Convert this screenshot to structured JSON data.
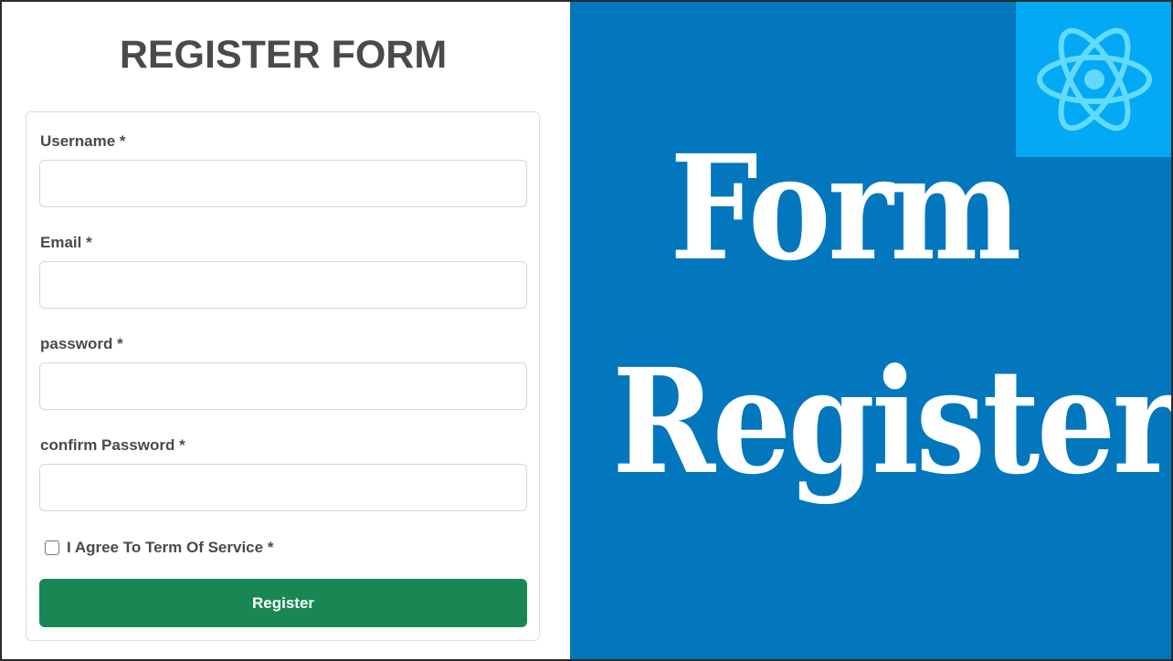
{
  "form": {
    "title": "REGISTER FORM",
    "fields": [
      {
        "label": "Username *",
        "value": "",
        "placeholder": ""
      },
      {
        "label": "Email *",
        "value": "",
        "placeholder": ""
      },
      {
        "label": "password *",
        "value": "",
        "placeholder": ""
      },
      {
        "label": "confirm Password *",
        "value": "",
        "placeholder": ""
      }
    ],
    "agree_label": "I Agree To Term Of Service *",
    "agree_checked": false,
    "submit_label": "Register"
  },
  "banner": {
    "line1": "Form",
    "line2": "Register",
    "logo_icon": "react-logo-icon",
    "background_color": "#0277bd",
    "logo_background_color": "#03a9f4",
    "logo_color": "#61dafb"
  },
  "colors": {
    "button": "#198754",
    "text": "#4a4a4a"
  }
}
